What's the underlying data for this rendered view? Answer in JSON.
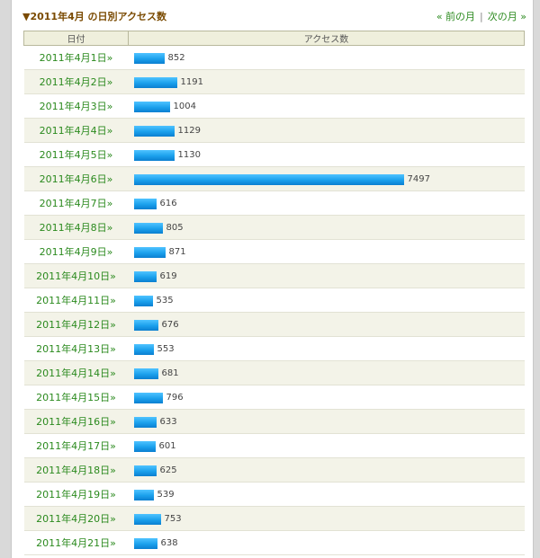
{
  "header": {
    "title": "▼2011年4月 の日別アクセス数",
    "prev_label": "« 前の月",
    "separator": "|",
    "next_label": "次の月 »"
  },
  "table": {
    "col_date": "日付",
    "col_access": "アクセス数"
  },
  "colors": {
    "bar": "#1aa0ec",
    "link": "#2b8a1e",
    "title": "#7a4a00"
  },
  "chart_data": {
    "type": "bar",
    "categories": [
      "2011年4月1日»",
      "2011年4月2日»",
      "2011年4月3日»",
      "2011年4月4日»",
      "2011年4月5日»",
      "2011年4月6日»",
      "2011年4月7日»",
      "2011年4月8日»",
      "2011年4月9日»",
      "2011年4月10日»",
      "2011年4月11日»",
      "2011年4月12日»",
      "2011年4月13日»",
      "2011年4月14日»",
      "2011年4月15日»",
      "2011年4月16日»",
      "2011年4月17日»",
      "2011年4月18日»",
      "2011年4月19日»",
      "2011年4月20日»",
      "2011年4月21日»"
    ],
    "values": [
      852,
      1191,
      1004,
      1129,
      1130,
      7497,
      616,
      805,
      871,
      619,
      535,
      676,
      553,
      681,
      796,
      633,
      601,
      625,
      539,
      753,
      638
    ],
    "title": "▼2011年4月 の日別アクセス数",
    "xlabel": "日付",
    "ylabel": "アクセス数",
    "ylim": [
      0,
      7497
    ]
  }
}
